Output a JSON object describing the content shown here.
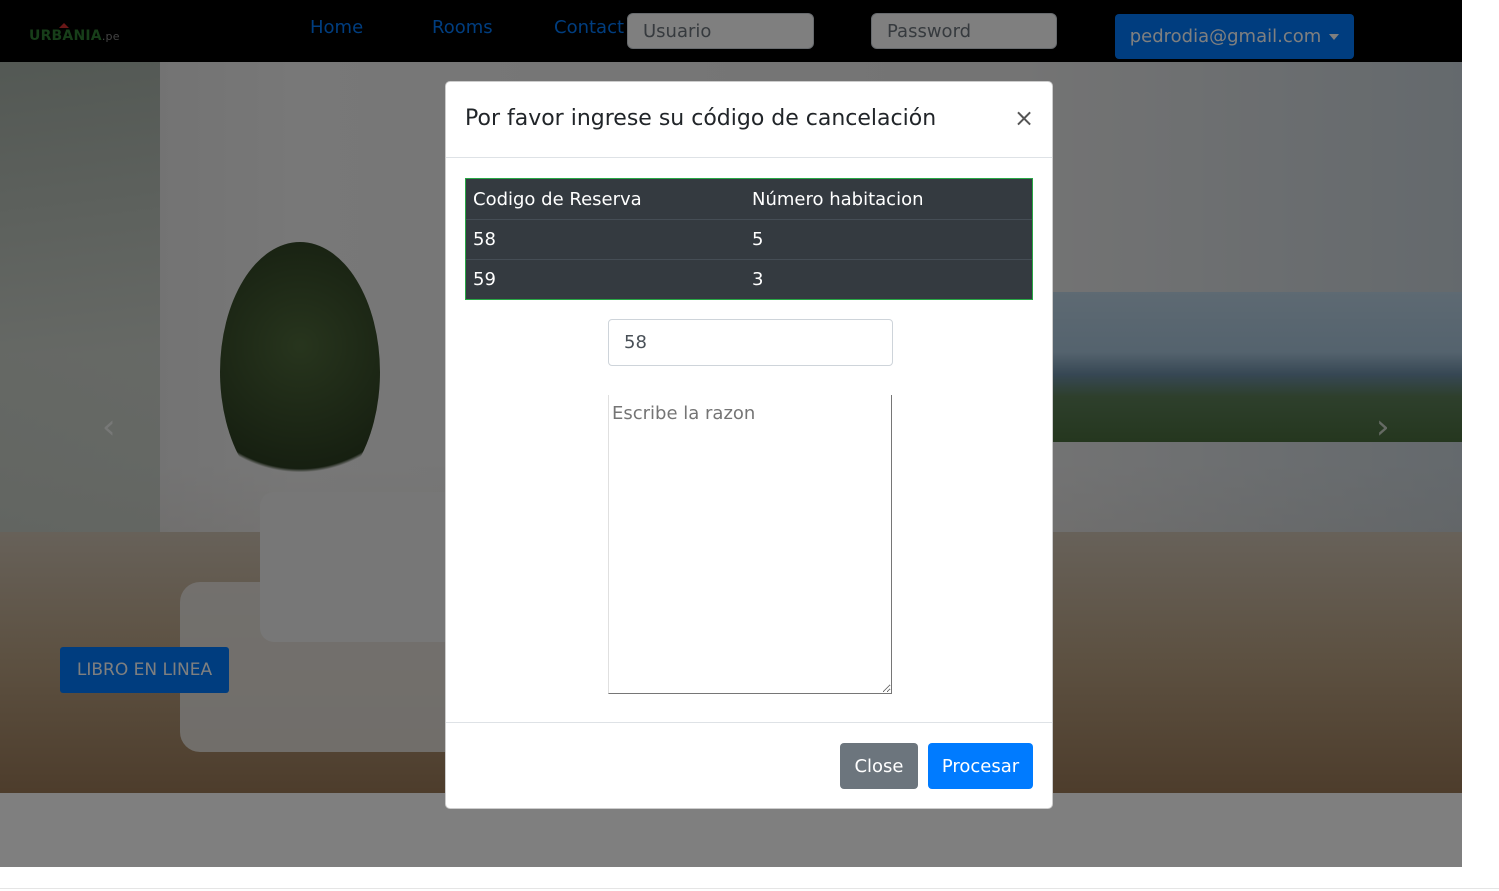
{
  "navbar": {
    "brand_main": "URBANIA",
    "brand_suffix": ".pe",
    "links": [
      "Home",
      "Rooms",
      "Contact"
    ],
    "user_placeholder": "Usuario",
    "password_placeholder": "Password",
    "account_label": "pedrodia@gmail.com"
  },
  "hero": {
    "book_button": "LIBRO EN LINEA",
    "prev_icon": "‹",
    "next_icon": "›"
  },
  "modal": {
    "title": "Por favor ingrese su código de cancelación",
    "close_icon": "×",
    "table": {
      "headers": [
        "Codigo de Reserva",
        "Número habitacion"
      ],
      "rows": [
        [
          "58",
          "5"
        ],
        [
          "59",
          "3"
        ]
      ]
    },
    "code_value": "58",
    "reason_placeholder": "Escribe la razon",
    "close_button": "Close",
    "process_button": "Procesar"
  },
  "colors": {
    "primary": "#007bff",
    "secondary": "#6c757d",
    "table_dark": "#343a40",
    "table_border": "#28a745"
  }
}
